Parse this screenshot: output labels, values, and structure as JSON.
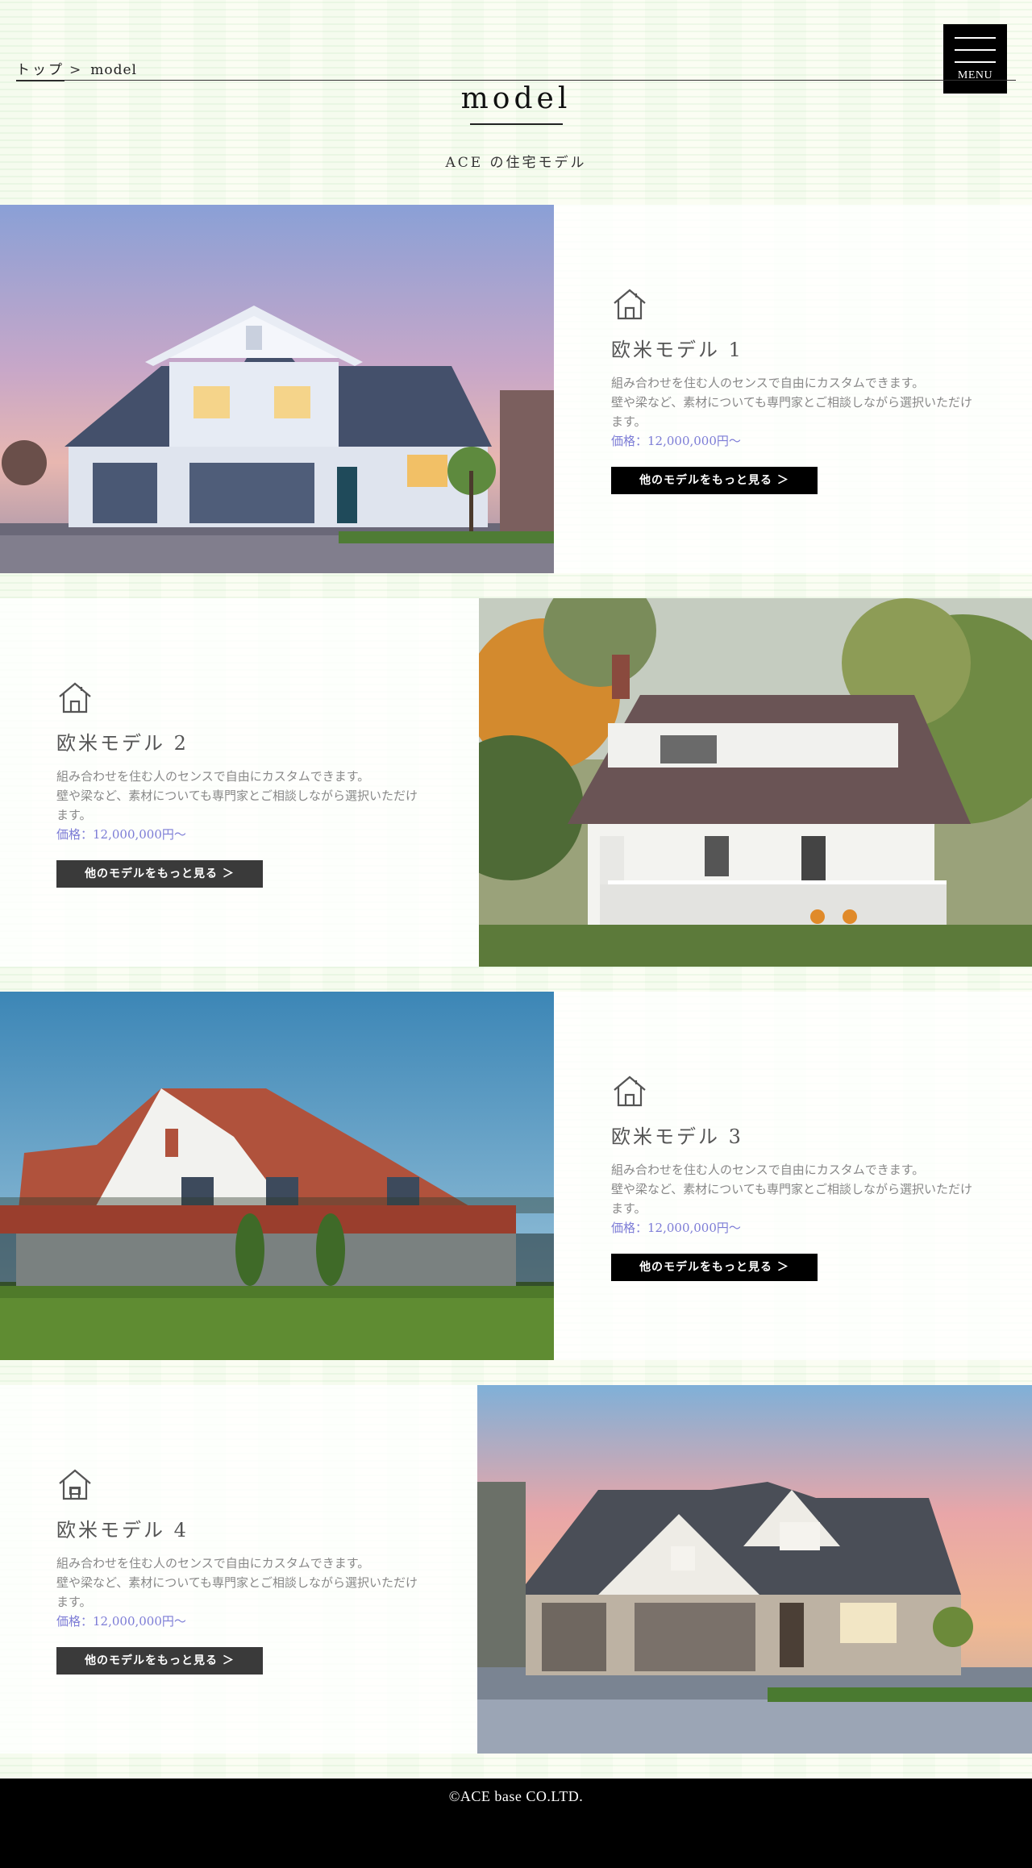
{
  "header": {
    "menu_label": "MENU",
    "breadcrumb": {
      "home": "トップ",
      "separator": ">",
      "current": "model"
    },
    "page_title": "model",
    "subtitle": "ACE の住宅モデル"
  },
  "models": [
    {
      "name": "欧米モデル 1",
      "description_line1": "組み合わせを住む人のセンスで自由にカスタムできます。",
      "description_line2": "壁や梁など、素材についても専門家とご相談しながら選択いただけます。",
      "price": "価格：12,000,000円〜",
      "button": "他のモデルをもっと見る ＞",
      "photo": "suburban-house-dusk"
    },
    {
      "name": "欧米モデル 2",
      "description_line1": "組み合わせを住む人のセンスで自由にカスタムできます。",
      "description_line2": "壁や梁など、素材についても専門家とご相談しながら選択いただけます。",
      "price": "価格：12,000,000円〜",
      "button": "他のモデルをもっと見る ＞",
      "photo": "white-porch-house-trees"
    },
    {
      "name": "欧米モデル 3",
      "description_line1": "組み合わせを住む人のセンスで自由にカスタムできます。",
      "description_line2": "壁や梁など、素材についても専門家とご相談しながら選択いただけます。",
      "price": "価格：12,000,000円〜",
      "button": "他のモデルをもっと見る ＞",
      "photo": "tudor-house-lawn"
    },
    {
      "name": "欧米モデル 4",
      "description_line1": "組み合わせを住む人のセンスで自由にカスタムできます。",
      "description_line2": "壁や梁など、素材についても専門家とご相談しながら選択いただけます。",
      "price": "価格：12,000,000円〜",
      "button": "他のモデルをもっと見る ＞",
      "photo": "craftsman-house-sunset"
    }
  ],
  "footer": {
    "copyright": "©ACE base CO.LTD."
  },
  "colors": {
    "price": "#7c7cd6",
    "button_black": "#000000",
    "button_gray": "#3a3a3a",
    "footer": "#000000"
  }
}
